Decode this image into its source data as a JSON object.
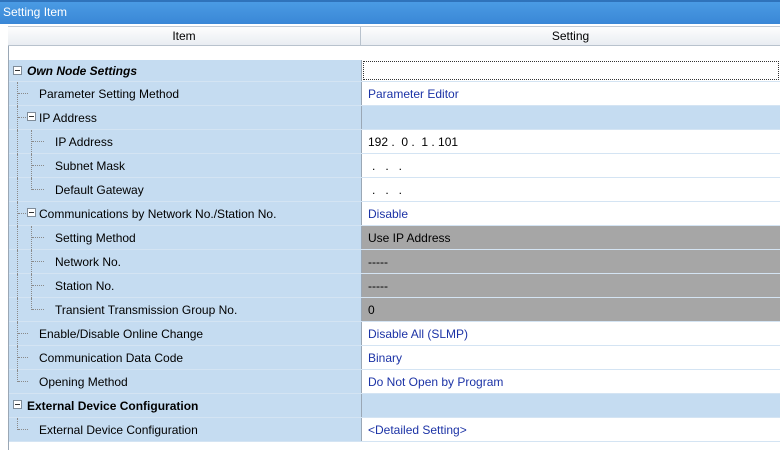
{
  "window": {
    "title": "Setting Item"
  },
  "columns": {
    "item": "Item",
    "setting": "Setting"
  },
  "rows": [
    {
      "label": "Own Node Settings",
      "value": ""
    },
    {
      "label": "Parameter Setting Method",
      "value": "Parameter Editor"
    },
    {
      "label": "IP Address",
      "value": ""
    },
    {
      "label": "IP Address",
      "value": "192 .  0 .  1 . 101"
    },
    {
      "label": "Subnet Mask",
      "value": ".   .   ."
    },
    {
      "label": "Default Gateway",
      "value": ".   .   ."
    },
    {
      "label": "Communications by Network No./Station No.",
      "value": "Disable"
    },
    {
      "label": "Setting Method",
      "value": "Use IP Address"
    },
    {
      "label": "Network No.",
      "value": "-----"
    },
    {
      "label": "Station No.",
      "value": "-----"
    },
    {
      "label": "Transient Transmission Group No.",
      "value": "0"
    },
    {
      "label": "Enable/Disable Online Change",
      "value": "Disable All (SLMP)"
    },
    {
      "label": "Communication Data Code",
      "value": "Binary"
    },
    {
      "label": "Opening Method",
      "value": "Do Not Open by Program"
    },
    {
      "label": "External Device Configuration",
      "value": ""
    },
    {
      "label": "External Device Configuration",
      "value": "<Detailed Setting>"
    }
  ]
}
